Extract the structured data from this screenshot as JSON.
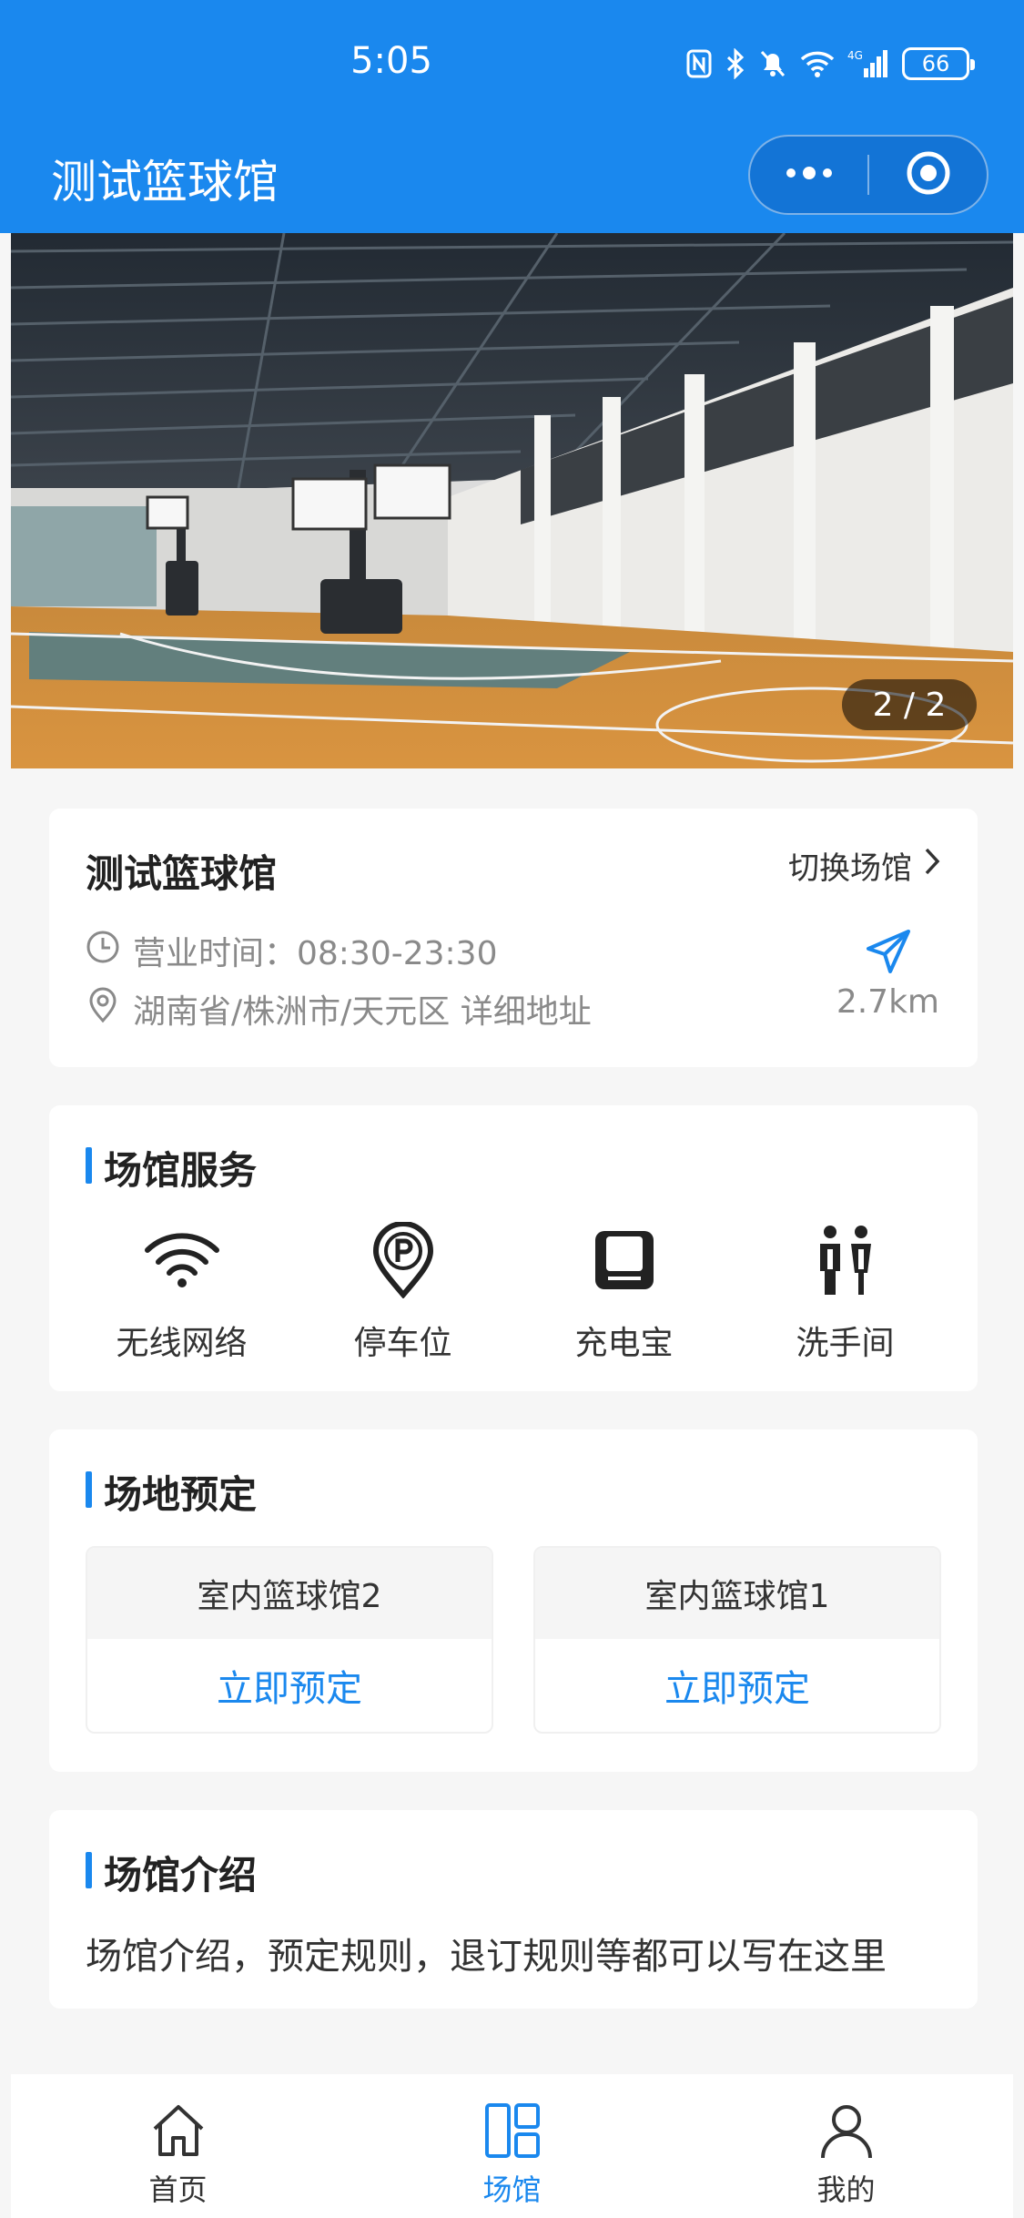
{
  "status_bar": {
    "time": "5:05",
    "battery": "66",
    "network": "4G"
  },
  "nav": {
    "title": "测试篮球馆"
  },
  "banner": {
    "counter": "2 / 2"
  },
  "venue": {
    "name": "测试篮球馆",
    "switch_label": "切换场馆",
    "hours": "营业时间：08:30-23:30",
    "address": "湖南省/株洲市/天元区 详细地址",
    "distance": "2.7km"
  },
  "services": {
    "title": "场馆服务",
    "items": [
      {
        "label": "无线网络",
        "icon": "wifi-icon"
      },
      {
        "label": "停车位",
        "icon": "parking-icon"
      },
      {
        "label": "充电宝",
        "icon": "power-bank-icon"
      },
      {
        "label": "洗手间",
        "icon": "restroom-icon"
      }
    ]
  },
  "booking": {
    "title": "场地预定",
    "courts": [
      {
        "name": "室内篮球馆2",
        "action": "立即预定"
      },
      {
        "name": "室内篮球馆1",
        "action": "立即预定"
      }
    ]
  },
  "intro": {
    "title": "场馆介绍",
    "text": "场馆介绍，预定规则，退订规则等都可以写在这里"
  },
  "tabbar": {
    "items": [
      {
        "label": "首页",
        "icon": "home-icon",
        "active": false
      },
      {
        "label": "场馆",
        "icon": "venue-icon",
        "active": true
      },
      {
        "label": "我的",
        "icon": "profile-icon",
        "active": false
      }
    ]
  },
  "colors": {
    "accent": "#1a88ee",
    "background": "#f6f6f6",
    "muted_text": "#8a8a8a"
  }
}
